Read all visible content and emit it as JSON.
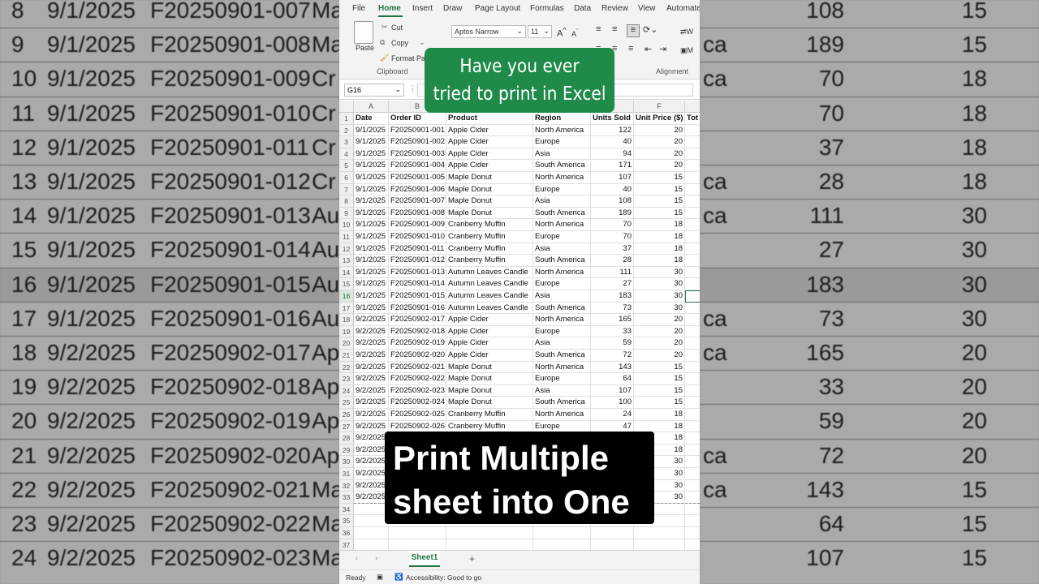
{
  "ribbon_tabs": [
    "File",
    "Home",
    "Insert",
    "Draw",
    "Page Layout",
    "Formulas",
    "Data",
    "Review",
    "View",
    "Automate"
  ],
  "ribbon": {
    "paste": "Paste",
    "cut": "Cut",
    "copy": "Copy",
    "format_painter": "Format Painter",
    "clipboard": "Clipboard",
    "font_name": "Aptos Narrow",
    "font_size": "11",
    "alignment": "Alignment",
    "wrap": "W",
    "merge": "M"
  },
  "name_box": "G16",
  "columns": [
    "A",
    "B",
    "C",
    "D",
    "E",
    "F"
  ],
  "col_overflow": "Tot",
  "headers": [
    "Date",
    "Order ID",
    "Product",
    "Region",
    "Units Sold",
    "Unit Price ($)",
    "Tot"
  ],
  "rows": [
    [
      "9/1/2025",
      "F20250901-001",
      "Apple Cider",
      "North America",
      "122",
      "20"
    ],
    [
      "9/1/2025",
      "F20250901-002",
      "Apple Cider",
      "Europe",
      "40",
      "20"
    ],
    [
      "9/1/2025",
      "F20250901-003",
      "Apple Cider",
      "Asia",
      "94",
      "20"
    ],
    [
      "9/1/2025",
      "F20250901-004",
      "Apple Cider",
      "South America",
      "171",
      "20"
    ],
    [
      "9/1/2025",
      "F20250901-005",
      "Maple Donut",
      "North America",
      "107",
      "15"
    ],
    [
      "9/1/2025",
      "F20250901-006",
      "Maple Donut",
      "Europe",
      "40",
      "15"
    ],
    [
      "9/1/2025",
      "F20250901-007",
      "Maple Donut",
      "Asia",
      "108",
      "15"
    ],
    [
      "9/1/2025",
      "F20250901-008",
      "Maple Donut",
      "South America",
      "189",
      "15"
    ],
    [
      "9/1/2025",
      "F20250901-009",
      "Cranberry Muffin",
      "North America",
      "70",
      "18"
    ],
    [
      "9/1/2025",
      "F20250901-010",
      "Cranberry Muffin",
      "Europe",
      "70",
      "18"
    ],
    [
      "9/1/2025",
      "F20250901-011",
      "Cranberry Muffin",
      "Asia",
      "37",
      "18"
    ],
    [
      "9/1/2025",
      "F20250901-012",
      "Cranberry Muffin",
      "South America",
      "28",
      "18"
    ],
    [
      "9/1/2025",
      "F20250901-013",
      "Autumn Leaves Candle",
      "North America",
      "111",
      "30"
    ],
    [
      "9/1/2025",
      "F20250901-014",
      "Autumn Leaves Candle",
      "Europe",
      "27",
      "30"
    ],
    [
      "9/1/2025",
      "F20250901-015",
      "Autumn Leaves Candle",
      "Asia",
      "183",
      "30"
    ],
    [
      "9/1/2025",
      "F20250901-016",
      "Autumn Leaves Candle",
      "South America",
      "73",
      "30"
    ],
    [
      "9/2/2025",
      "F20250902-017",
      "Apple Cider",
      "North America",
      "165",
      "20"
    ],
    [
      "9/2/2025",
      "F20250902-018",
      "Apple Cider",
      "Europe",
      "33",
      "20"
    ],
    [
      "9/2/2025",
      "F20250902-019",
      "Apple Cider",
      "Asia",
      "59",
      "20"
    ],
    [
      "9/2/2025",
      "F20250902-020",
      "Apple Cider",
      "South America",
      "72",
      "20"
    ],
    [
      "9/2/2025",
      "F20250902-021",
      "Maple Donut",
      "North America",
      "143",
      "15"
    ],
    [
      "9/2/2025",
      "F20250902-022",
      "Maple Donut",
      "Europe",
      "64",
      "15"
    ],
    [
      "9/2/2025",
      "F20250902-023",
      "Maple Donut",
      "Asia",
      "107",
      "15"
    ],
    [
      "9/2/2025",
      "F20250902-024",
      "Maple Donut",
      "South America",
      "100",
      "15"
    ],
    [
      "9/2/2025",
      "F20250902-025",
      "Cranberry Muffin",
      "North America",
      "24",
      "18"
    ],
    [
      "9/2/2025",
      "F20250902-026",
      "Cranberry Muffin",
      "Europe",
      "47",
      "18"
    ],
    [
      "9/2/2025",
      "",
      "",
      "",
      "",
      "18"
    ],
    [
      "9/2/2025",
      "",
      "",
      "",
      "",
      "18"
    ],
    [
      "9/2/2025",
      "",
      "",
      "",
      "",
      "30"
    ],
    [
      "9/2/2025",
      "",
      "",
      "",
      "",
      "30"
    ],
    [
      "9/2/2025",
      "",
      "",
      "",
      "",
      "30"
    ],
    [
      "9/2/2025",
      "",
      "",
      "",
      "",
      "30"
    ]
  ],
  "empty_rows": [
    "34",
    "35",
    "36",
    "37"
  ],
  "sheet_tab": "Sheet1",
  "add_sheet": "+",
  "status": {
    "ready": "Ready",
    "accessibility": "Accessibility: Good to go"
  },
  "overlay_green": [
    "Have you ever",
    "tried to print in Excel"
  ],
  "overlay_black": [
    "Print Multiple",
    "sheet into One"
  ],
  "bg_left": [
    {
      "r": "8",
      "d": "9/1/2025",
      "id": "F20250901-007",
      "p": "Ma"
    },
    {
      "r": "9",
      "d": "9/1/2025",
      "id": "F20250901-008",
      "p": "Ma"
    },
    {
      "r": "10",
      "d": "9/1/2025",
      "id": "F20250901-009",
      "p": "Cr"
    },
    {
      "r": "11",
      "d": "9/1/2025",
      "id": "F20250901-010",
      "p": "Cr"
    },
    {
      "r": "12",
      "d": "9/1/2025",
      "id": "F20250901-011",
      "p": "Cr"
    },
    {
      "r": "13",
      "d": "9/1/2025",
      "id": "F20250901-012",
      "p": "Cr"
    },
    {
      "r": "14",
      "d": "9/1/2025",
      "id": "F20250901-013",
      "p": "Au"
    },
    {
      "r": "15",
      "d": "9/1/2025",
      "id": "F20250901-014",
      "p": "Au"
    },
    {
      "r": "16",
      "d": "9/1/2025",
      "id": "F20250901-015",
      "p": "Au"
    },
    {
      "r": "17",
      "d": "9/1/2025",
      "id": "F20250901-016",
      "p": "Au"
    },
    {
      "r": "18",
      "d": "9/2/2025",
      "id": "F20250902-017",
      "p": "Ap"
    },
    {
      "r": "19",
      "d": "9/2/2025",
      "id": "F20250902-018",
      "p": "Ap"
    },
    {
      "r": "20",
      "d": "9/2/2025",
      "id": "F20250902-019",
      "p": "Ap"
    },
    {
      "r": "21",
      "d": "9/2/2025",
      "id": "F20250902-020",
      "p": "Ap"
    },
    {
      "r": "22",
      "d": "9/2/2025",
      "id": "F20250902-021",
      "p": "Ma"
    },
    {
      "r": "23",
      "d": "9/2/2025",
      "id": "F20250902-022",
      "p": "Ma"
    },
    {
      "r": "24",
      "d": "9/2/2025",
      "id": "F20250902-023",
      "p": "Ma"
    }
  ],
  "bg_right": [
    {
      "reg": "",
      "u": "108",
      "pr": "15"
    },
    {
      "reg": "ca",
      "u": "189",
      "pr": "15"
    },
    {
      "reg": "ca",
      "u": "70",
      "pr": "18"
    },
    {
      "reg": "",
      "u": "70",
      "pr": "18"
    },
    {
      "reg": "",
      "u": "37",
      "pr": "18"
    },
    {
      "reg": "ca",
      "u": "28",
      "pr": "18"
    },
    {
      "reg": "ca",
      "u": "111",
      "pr": "30"
    },
    {
      "reg": "",
      "u": "27",
      "pr": "30"
    },
    {
      "reg": "",
      "u": "183",
      "pr": "30"
    },
    {
      "reg": "ca",
      "u": "73",
      "pr": "30"
    },
    {
      "reg": "ca",
      "u": "165",
      "pr": "20"
    },
    {
      "reg": "",
      "u": "33",
      "pr": "20"
    },
    {
      "reg": "",
      "u": "59",
      "pr": "20"
    },
    {
      "reg": "ca",
      "u": "72",
      "pr": "20"
    },
    {
      "reg": "ca",
      "u": "143",
      "pr": "15"
    },
    {
      "reg": "",
      "u": "64",
      "pr": "15"
    },
    {
      "reg": "",
      "u": "107",
      "pr": "15"
    }
  ],
  "colors": {
    "excel_green": "#217346",
    "overlay_green": "#1f8a4a"
  }
}
